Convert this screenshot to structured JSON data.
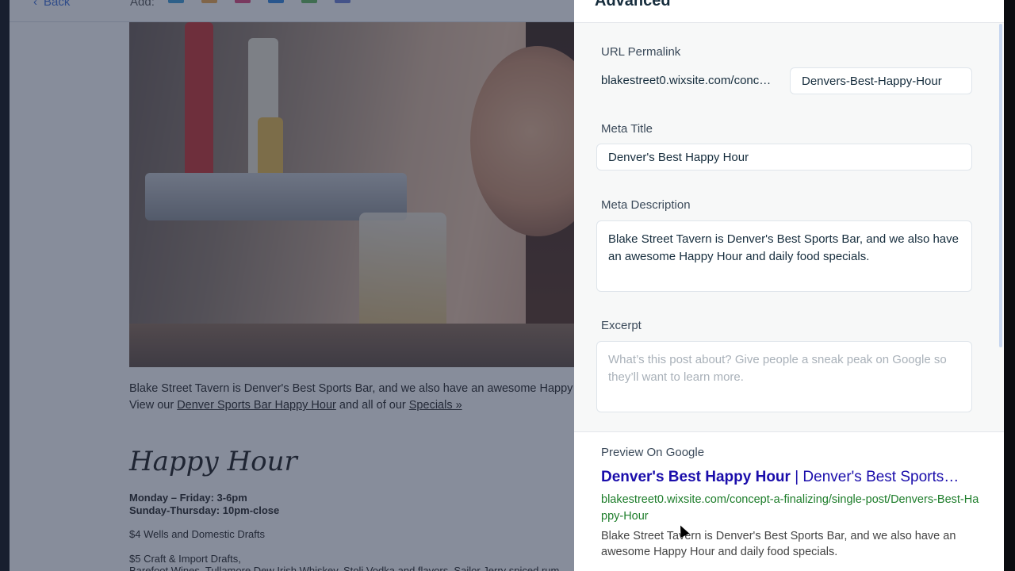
{
  "editor": {
    "back_label": "Back",
    "add_label": "Add:",
    "body_line1": "Blake Street Tavern is Denver's Best Sports Bar, and we also have an awesome Happy",
    "body_line2_prefix": "View our",
    "link_happy_hour": "Denver Sports Bar Happy Hour",
    "body_line2_mid": "and all of our",
    "link_specials": "Specials »",
    "section_title": "Happy Hour",
    "hours_line1": "Monday – Friday: 3-6pm",
    "hours_line2": "Sunday-Thursday: 10pm-close",
    "deal1": "$4 Wells and Domestic Drafts",
    "deal2": "$5 Craft & Import Drafts,",
    "deal3": "Barefoot Wines, Tullamore Dew Irish Whiskey, Stoli Vodka and flavors, Sailor Jerry spiced rum"
  },
  "panel": {
    "title": "Advanced",
    "url_label": "URL Permalink",
    "url_prefix": "blakestreet0.wixsite.com/conc…",
    "url_slug": "Denvers-Best-Happy-Hour",
    "meta_title_label": "Meta Title",
    "meta_title_value": "Denver's Best Happy Hour",
    "meta_desc_label": "Meta Description",
    "meta_desc_value": "Blake Street Tavern is Denver's Best Sports Bar, and we also have an awesome Happy Hour and daily food specials.",
    "excerpt_label": "Excerpt",
    "excerpt_placeholder": "What’s this post about? Give people a sneak peak on Google so they’ll want to learn more.",
    "preview_label": "Preview On Google",
    "preview_title_bold": "Denver's Best Happy Hour",
    "preview_title_rest": " | Denver's Best Sports…",
    "preview_url": "blakestreet0.wixsite.com/concept-a-finalizing/single-post/Denvers-Best-Happy-Hour",
    "preview_desc": "Blake Street Tavern is Denver's Best Sports Bar, and we also have an awesome Happy Hour and daily food specials."
  },
  "colors": {
    "accent": "#3a6ed8",
    "google_title": "#1a0dab",
    "google_url": "#1d7d2a",
    "overlay": "#253048"
  }
}
